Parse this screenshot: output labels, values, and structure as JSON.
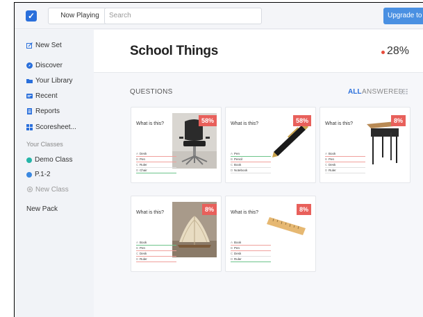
{
  "topbar": {
    "now_playing": "Now Playing",
    "search_placeholder": "Search",
    "upgrade": "Upgrade to P"
  },
  "sidebar": {
    "items": [
      {
        "label": "New Set",
        "icon": "edit-icon"
      },
      {
        "label": "Discover",
        "icon": "compass-icon"
      },
      {
        "label": "Your Library",
        "icon": "folder-icon"
      },
      {
        "label": "Recent",
        "icon": "clock-icon"
      },
      {
        "label": "Reports",
        "icon": "document-icon"
      },
      {
        "label": "Scoresheet...",
        "icon": "grid-icon"
      }
    ],
    "classes_label": "Your Classes",
    "classes": [
      {
        "label": "Demo Class",
        "color": "#26b5a8"
      },
      {
        "label": "P.1-2",
        "color": "#3b88e0"
      },
      {
        "label": "New Class",
        "color": "#aaaaaa"
      }
    ],
    "new_pack": "New Pack"
  },
  "header": {
    "title": "School Things",
    "percent": "28%"
  },
  "questions": {
    "label": "QUESTIONS",
    "filter_all": "ALL",
    "filter_answered": "ANSWERED",
    "cards": [
      {
        "question": "What is this?",
        "percent": "58%",
        "image": "chair-image",
        "options": [
          "Desk",
          "Pen",
          "Ruler",
          "Chair"
        ]
      },
      {
        "question": "What is this?",
        "percent": "58%",
        "image": "pen-image",
        "options": [
          "Pen",
          "Pencil",
          "Book",
          "Notebook"
        ]
      },
      {
        "question": "What is this?",
        "percent": "8%",
        "image": "desk-image",
        "options": [
          "Book",
          "Pen",
          "Desk",
          "Ruler"
        ]
      },
      {
        "question": "What is this?",
        "percent": "8%",
        "image": "book-image",
        "options": [
          "Book",
          "Pen",
          "Desk",
          "Ruler"
        ]
      },
      {
        "question": "What is this?",
        "percent": "8%",
        "image": "ruler-image",
        "options": [
          "Book",
          "Pen",
          "Desk",
          "Ruler"
        ]
      }
    ]
  },
  "colors": {
    "accent": "#2a6fdb",
    "badge": "#e8605b",
    "upgrade": "#4a90e2"
  }
}
